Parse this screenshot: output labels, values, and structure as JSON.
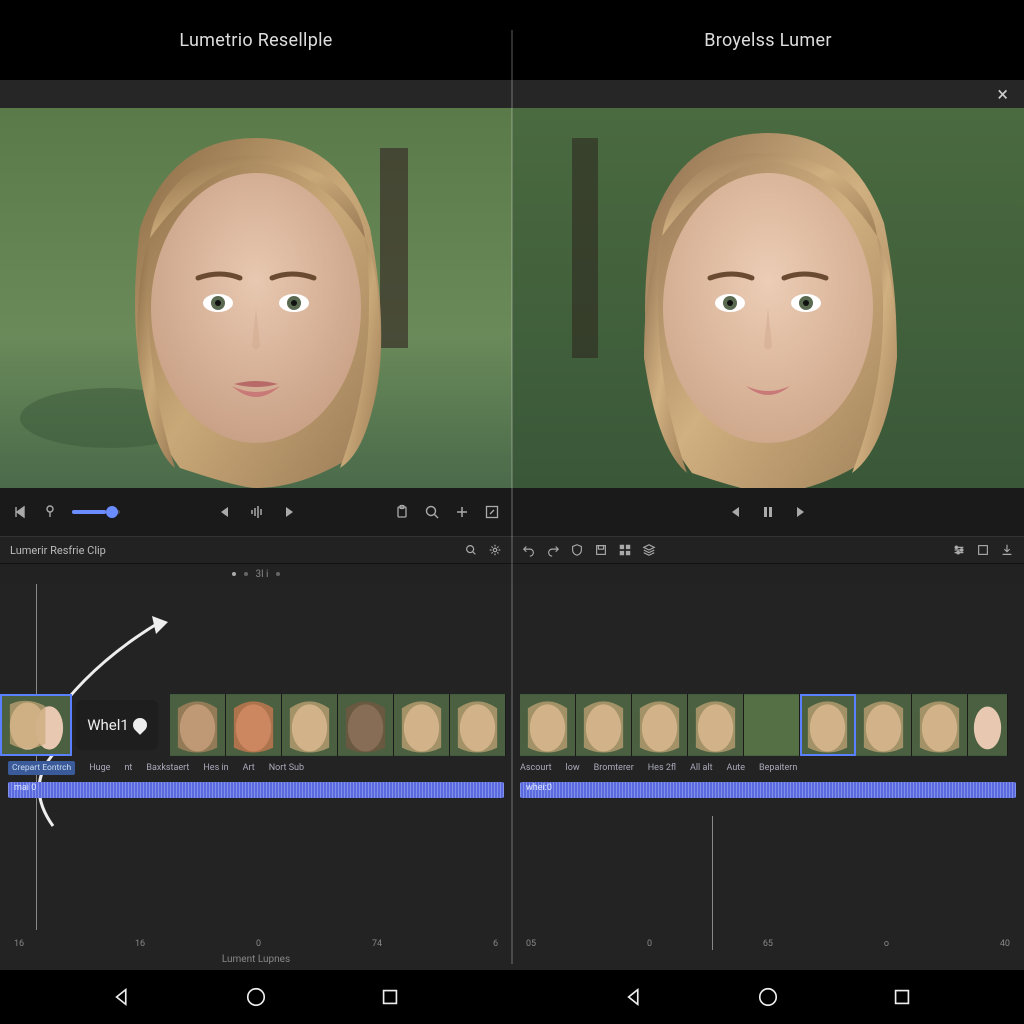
{
  "left": {
    "header": {
      "title": "Lumetrio Resellple"
    },
    "panel_strip": {
      "label": "Lumerir Resfrie Clip"
    },
    "pager_text": "3l i",
    "whel_label": "Whel1",
    "tags": [
      "Crepart Eontrch",
      "Huge",
      "nt",
      "Baxkstaert",
      "Hes in",
      "Art",
      "Nort Sub"
    ],
    "audio_label": "mai 0",
    "ruler": [
      "16",
      "16",
      "0",
      "74",
      "6"
    ],
    "bottom_label": "Lument Lupnes"
  },
  "right": {
    "header": {
      "title": "Broyelss Lumer"
    },
    "tags": [
      "Ascourt",
      "low",
      "Bromterer",
      "Hes 2fl",
      "All alt",
      "Aute",
      "Bepaitern"
    ],
    "audio_label": "whei:0",
    "ruler": [
      "05",
      "0",
      "65",
      "o",
      "40"
    ]
  },
  "icons": {
    "close": "×"
  }
}
